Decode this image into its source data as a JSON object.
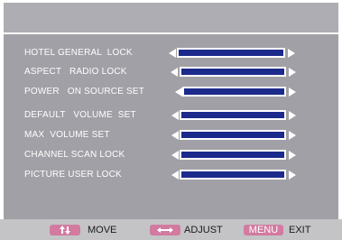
{
  "menu": {
    "title": "",
    "items": [
      {
        "label": "HOTEL GENERAL  LOCK",
        "value_fraction": 1.0
      },
      {
        "label": "ASPECT   RADIO LOCK",
        "value_fraction": 1.0
      },
      {
        "label": "POWER   ON SOURCE SET",
        "value_fraction": 1.0
      },
      {
        "label": "DEFAULT   VOLUME  SET",
        "value_fraction": 1.0
      },
      {
        "label": "MAX  VOLUME SET",
        "value_fraction": 1.0
      },
      {
        "label": "CHANNEL SCAN LOCK",
        "value_fraction": 1.0
      },
      {
        "label": "PICTURE USER LOCK",
        "value_fraction": 1.0
      }
    ]
  },
  "footer": {
    "move_label": "MOVE",
    "adjust_label": "ADJUST",
    "menu_key_label": "MENU",
    "exit_label": "EXIT"
  },
  "colors": {
    "panel": "#a0a0a6",
    "bar_fill": "#1c2a8c",
    "key_badge": "#d27aa0",
    "footer": "#c4c4c6"
  },
  "icons": {
    "move": "up-down-arrows-icon",
    "adjust": "left-right-arrows-icon",
    "item_left": "left-arrow-icon",
    "item_right": "right-arrow-icon"
  }
}
